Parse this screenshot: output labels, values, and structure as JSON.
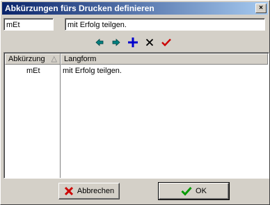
{
  "window": {
    "title": "Abkürzungen fürs Drucken definieren",
    "close_glyph": "×"
  },
  "fields": {
    "abbreviation_value": "mEt",
    "longform_value": "mit Erfolg teilgen."
  },
  "toolbar": {
    "icons": [
      "arrow-left-icon",
      "arrow-right-icon",
      "plus-icon",
      "delete-x-icon",
      "checkmark-icon"
    ],
    "colors": {
      "arrows": "#008080",
      "plus": "#0000cc",
      "delete": "#000000",
      "check": "#cc0000"
    }
  },
  "list": {
    "columns": [
      {
        "label": "Abkürzung",
        "sort_glyph": "△"
      },
      {
        "label": "Langform"
      }
    ],
    "rows": [
      {
        "abbreviation": "mEt",
        "longform": "mit Erfolg teilgen."
      }
    ]
  },
  "buttons": {
    "cancel_label": "Abbrechen",
    "ok_label": "OK"
  }
}
